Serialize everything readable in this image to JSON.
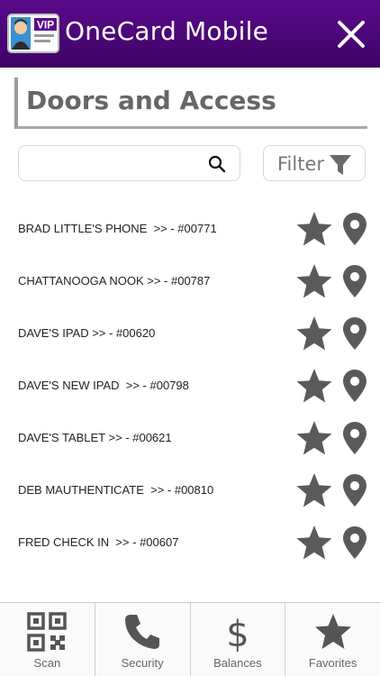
{
  "header": {
    "title": "OneCard Mobile",
    "logo_badge": "VIP",
    "close_icon": "close-icon",
    "bg_color": "#4a0676"
  },
  "page": {
    "title": "Doors and Access"
  },
  "search": {
    "value": "",
    "placeholder": ""
  },
  "filter": {
    "label": "Filter"
  },
  "doors": [
    {
      "label": "BRAD LITTLE'S PHONE  >> - #00771"
    },
    {
      "label": "CHATTANOOGA NOOK >> - #00787"
    },
    {
      "label": "DAVE'S IPAD >> - #00620"
    },
    {
      "label": "DAVE'S NEW IPAD  >> - #00798"
    },
    {
      "label": "DAVE'S TABLET >> - #00621"
    },
    {
      "label": "DEB MAUTHENTICATE  >> - #00810"
    },
    {
      "label": "FRED CHECK IN  >> - #00607"
    }
  ],
  "bottom_nav": [
    {
      "label": "Scan",
      "icon": "qr-code-icon"
    },
    {
      "label": "Security",
      "icon": "phone-icon"
    },
    {
      "label": "Balances",
      "icon": "dollar-icon"
    },
    {
      "label": "Favorites",
      "icon": "star-icon"
    }
  ],
  "colors": {
    "icon_gray": "#5a5a5a",
    "header_purple": "#4a0676"
  }
}
